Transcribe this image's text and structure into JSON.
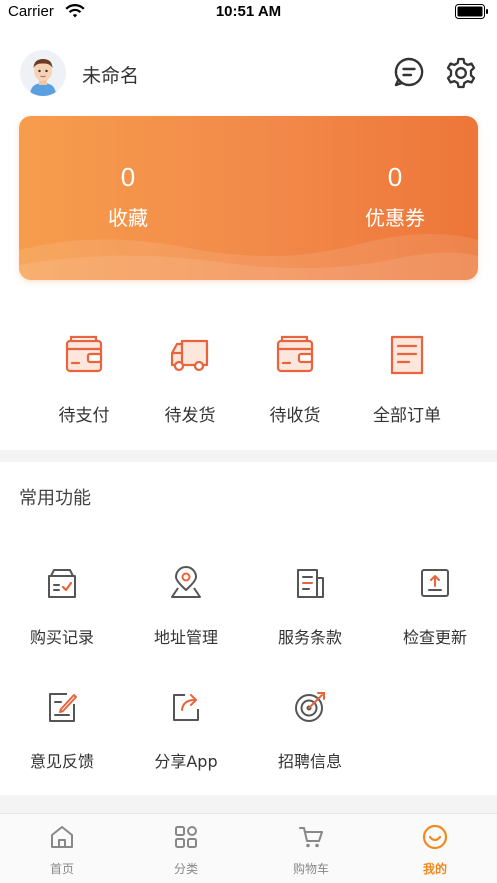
{
  "status_bar": {
    "carrier": "Carrier",
    "time": "10:51 AM"
  },
  "profile": {
    "username": "未命名",
    "avatar_icon": "user-avatar",
    "message_icon": "message-icon",
    "settings_icon": "gear-icon"
  },
  "stats": [
    {
      "value": "0",
      "label": "收藏"
    },
    {
      "value": "0",
      "label": "优惠券"
    }
  ],
  "orders": [
    {
      "label": "待支付",
      "icon": "wallet-icon"
    },
    {
      "label": "待发货",
      "icon": "truck-icon"
    },
    {
      "label": "待收货",
      "icon": "wallet-icon"
    },
    {
      "label": "全部订单",
      "icon": "document-icon"
    }
  ],
  "functions": {
    "title": "常用功能",
    "items": [
      {
        "label": "购买记录",
        "icon": "purchase-record-icon"
      },
      {
        "label": "地址管理",
        "icon": "location-pin-icon"
      },
      {
        "label": "服务条款",
        "icon": "terms-icon"
      },
      {
        "label": "检查更新",
        "icon": "upload-icon"
      },
      {
        "label": "意见反馈",
        "icon": "edit-icon"
      },
      {
        "label": "分享App",
        "icon": "share-icon"
      },
      {
        "label": "招聘信息",
        "icon": "target-icon"
      }
    ]
  },
  "tabs": [
    {
      "label": "首页",
      "icon": "home-icon"
    },
    {
      "label": "分类",
      "icon": "grid-icon"
    },
    {
      "label": "购物车",
      "icon": "cart-icon"
    },
    {
      "label": "我的",
      "icon": "smile-icon",
      "active": true
    }
  ],
  "colors": {
    "accent": "#f08a1e",
    "order_icon": "#e8643c",
    "function_icon": "#555555",
    "card_start": "#f69d4c",
    "card_end": "#ed7638"
  }
}
